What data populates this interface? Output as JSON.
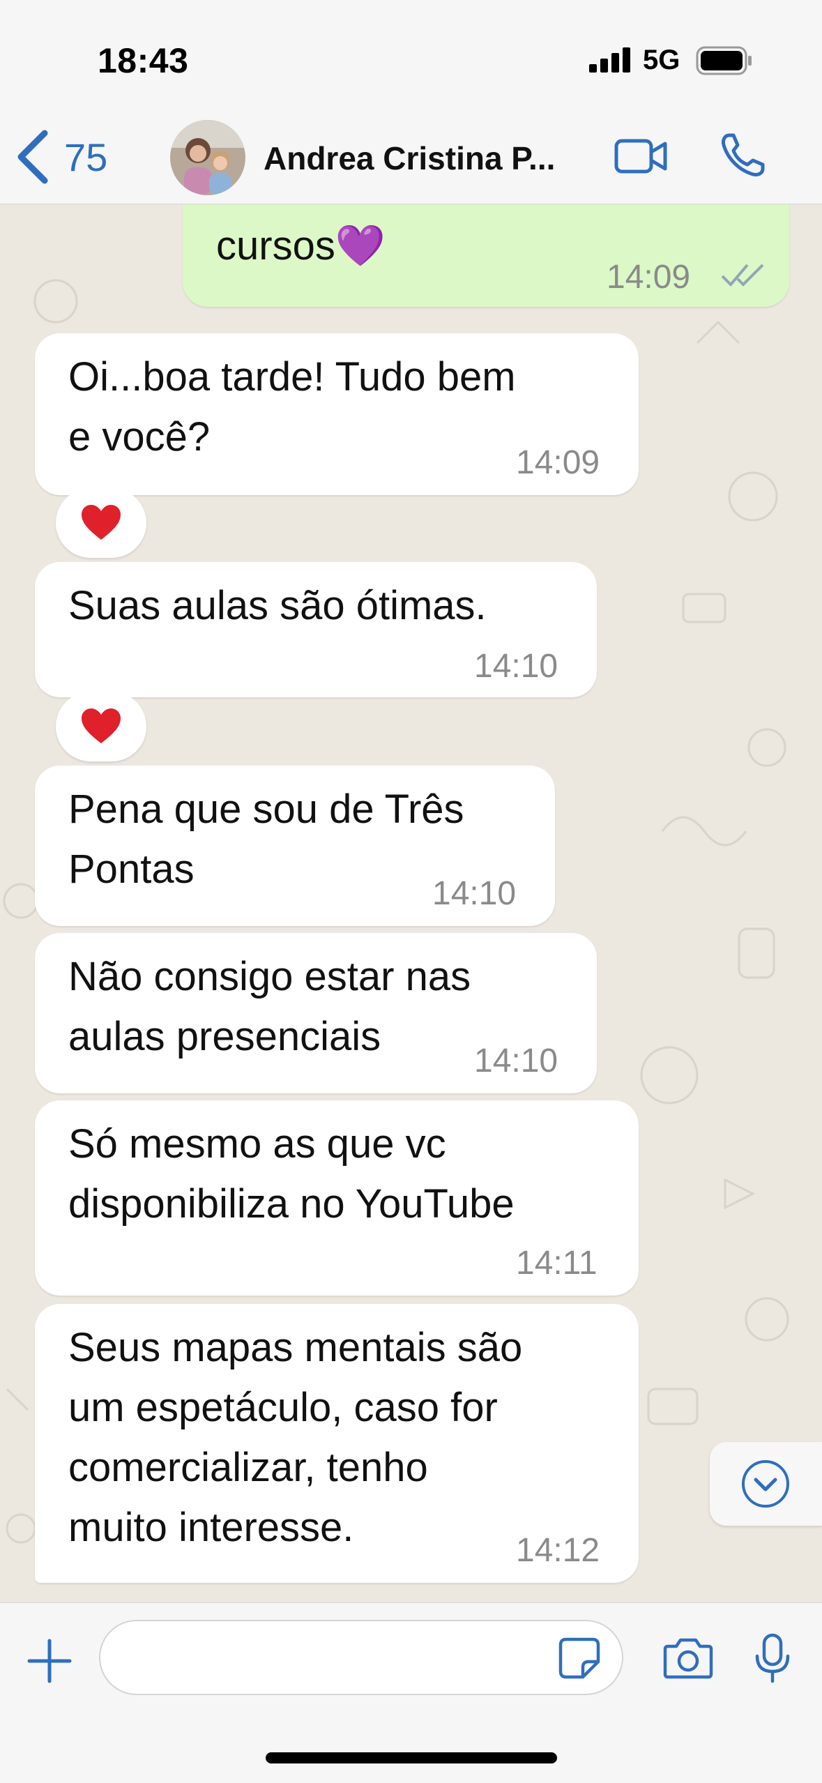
{
  "status_bar": {
    "time": "18:43",
    "network": "5G"
  },
  "header": {
    "back_count": "75",
    "contact_name": "Andrea Cristina P..."
  },
  "messages": [
    {
      "direction": "out",
      "text": "cursos💜",
      "time": "14:09",
      "status": "read"
    },
    {
      "direction": "in",
      "text": "Oi...boa tarde! Tudo bem\ne você?",
      "time": "14:09",
      "reaction": "❤️"
    },
    {
      "direction": "in",
      "text": "Suas aulas são ótimas.",
      "time": "14:10",
      "reaction": "❤️"
    },
    {
      "direction": "in",
      "text": "Pena que sou de Três\nPontas",
      "time": "14:10"
    },
    {
      "direction": "in",
      "text": "Não consigo estar nas\naulas presenciais",
      "time": "14:10"
    },
    {
      "direction": "in",
      "text": "Só mesmo as que vc\ndisponibiliza no YouTube",
      "time": "14:11"
    },
    {
      "direction": "in",
      "text": "Seus mapas mentais são\num espetáculo,  caso for\ncomercializar,  tenho\nmuito interesse.",
      "time": "14:12"
    }
  ],
  "input": {
    "value": "",
    "placeholder": ""
  },
  "icons": {
    "back": "chevron-left-icon",
    "video": "video-camera-icon",
    "phone": "phone-icon",
    "scroll": "chevron-down-circle-icon",
    "plus": "plus-icon",
    "sticker": "sticker-icon",
    "camera": "camera-icon",
    "mic": "microphone-icon",
    "read_receipt": "double-check-icon",
    "reaction": "heart-icon"
  },
  "colors": {
    "accent": "#2f6ebd",
    "outgoing_bubble": "#dcf8c6",
    "incoming_bubble": "#ffffff",
    "reaction_heart": "#e0202a"
  }
}
